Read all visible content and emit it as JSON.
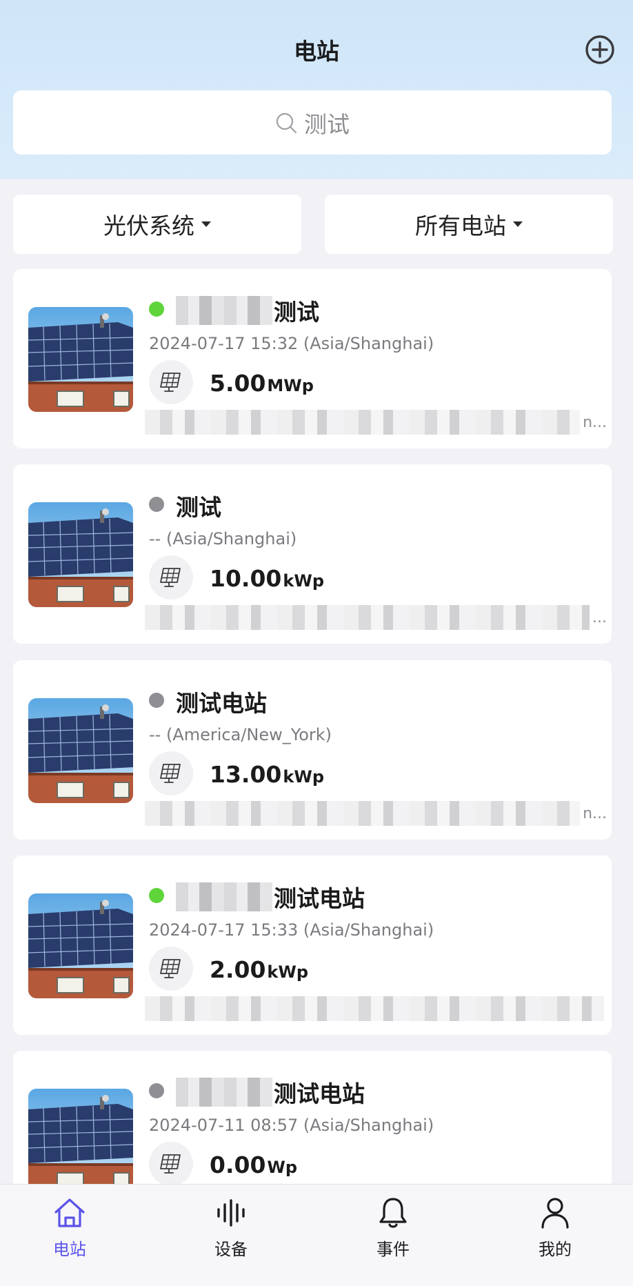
{
  "header": {
    "title": "电站",
    "add_icon": "plus-circle-icon"
  },
  "search": {
    "placeholder": "测试",
    "icon": "search-icon"
  },
  "filters": [
    {
      "label": "光伏系统",
      "icon": "caret-down-icon"
    },
    {
      "label": "所有电站",
      "icon": "caret-down-icon"
    }
  ],
  "stations": [
    {
      "status": "online",
      "status_color": "#5fd53b",
      "name": "测试",
      "time": "2024-07-17 15:32 (Asia/Shanghai)",
      "capacity": "5.00",
      "unit": "MWp",
      "address_tail": "n..."
    },
    {
      "status": "offline",
      "status_color": "#8e8e93",
      "name": "测试",
      "time": "-- (Asia/Shanghai)",
      "capacity": "10.00",
      "unit": "kWp",
      "address_tail": "..."
    },
    {
      "status": "offline",
      "status_color": "#8e8e93",
      "name": "测试电站",
      "time": "-- (America/New_York)",
      "capacity": "13.00",
      "unit": "kWp",
      "address_tail": "n..."
    },
    {
      "status": "online",
      "status_color": "#5fd53b",
      "name": "测试电站",
      "time": "2024-07-17 15:33 (Asia/Shanghai)",
      "capacity": "2.00",
      "unit": "kWp",
      "address_tail": ""
    },
    {
      "status": "offline",
      "status_color": "#8e8e93",
      "name": "测试电站",
      "time": "2024-07-11 08:57 (Asia/Shanghai)",
      "capacity": "0.00",
      "unit": "Wp",
      "address_tail": ""
    }
  ],
  "tabbar": [
    {
      "label": "电站",
      "icon": "home-icon",
      "active": true
    },
    {
      "label": "设备",
      "icon": "waveform-icon",
      "active": false
    },
    {
      "label": "事件",
      "icon": "bell-icon",
      "active": false
    },
    {
      "label": "我的",
      "icon": "person-icon",
      "active": false
    }
  ],
  "colors": {
    "accent": "#5b54e8",
    "online": "#5fd53b",
    "offline": "#8e8e93"
  }
}
